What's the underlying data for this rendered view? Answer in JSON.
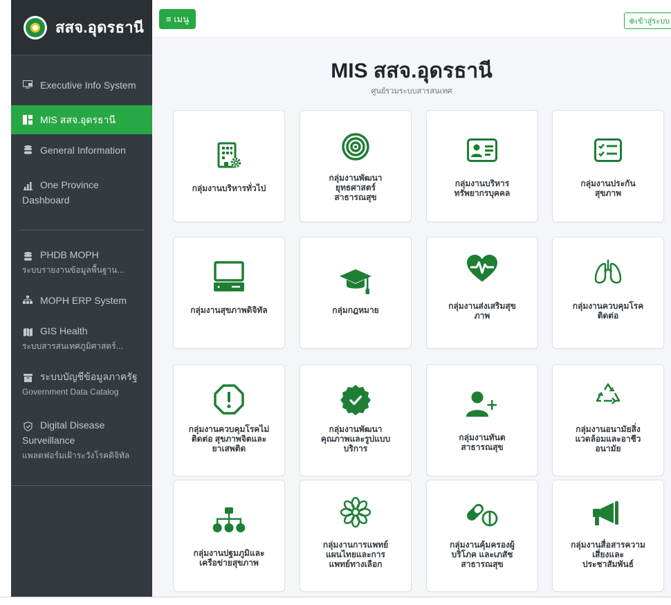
{
  "brand": {
    "title": "สสจ.อุดรธานี"
  },
  "topbar": {
    "menu_label": "≡ เมนู",
    "login_label": "⊕เข้าสู่ระบบ"
  },
  "sidebar": {
    "items": [
      {
        "label": "Executive Info System",
        "sub": "",
        "icon": "monitor-icon"
      },
      {
        "label": "MIS สสจ.อุดรธานี",
        "sub": "",
        "icon": "dashboard-icon",
        "active": true
      },
      {
        "label": "General Information",
        "sub": "",
        "icon": "database-icon"
      },
      {
        "label": "One Province",
        "label2": "Dashboard",
        "sub": "",
        "icon": "bar-chart-icon"
      },
      {
        "label": "PHDB MOPH",
        "sub": "ระบบรายงานข้อมูลพื้นฐาน...",
        "icon": "database-icon"
      },
      {
        "label": "MOPH ERP System",
        "sub": "",
        "icon": "sitemap-icon"
      },
      {
        "label": "GIS Health",
        "sub": "ระบบสารสนเทศภูมิศาสตร์...",
        "icon": "map-icon"
      },
      {
        "label": "ระบบบัญชีข้อมูลภาครัฐ",
        "sub": "Government Data Catalog",
        "icon": "archive-icon"
      },
      {
        "label": "Digital Disease",
        "label2": "Surveillance",
        "sub": "แพลตฟอร์มเฝ้าระวังโรคดิจิทัล",
        "icon": "shield-icon"
      }
    ]
  },
  "main": {
    "title": "MIS สสจ.อุดรธานี",
    "subtitle": "ศูนย์รวมระบบสารสนเทศ",
    "cards": [
      {
        "lines": [
          "กลุ่มงานบริหารทั่วไป"
        ],
        "icon": "building-gear-icon"
      },
      {
        "lines": [
          "กลุ่มงานพัฒนา",
          "ยุทธศาสตร์",
          "สาธารณสุข"
        ],
        "icon": "target-icon"
      },
      {
        "lines": [
          "กลุ่มงานบริหาร",
          "ทรัพยากรบุคคล"
        ],
        "icon": "id-card-icon"
      },
      {
        "lines": [
          "กลุ่มงานประกัน",
          "สุขภาพ"
        ],
        "icon": "checklist-icon"
      },
      {
        "lines": [
          "กลุ่มงานสุขภาพดิจิทัล"
        ],
        "icon": "computer-icon"
      },
      {
        "lines": [
          "กลุ่มกฎหมาย"
        ],
        "icon": "graduation-cap-icon"
      },
      {
        "lines": [
          "กลุ่มงานส่งเสริมสุข",
          "ภาพ"
        ],
        "icon": "heartbeat-icon"
      },
      {
        "lines": [
          "กลุ่มงานควบคุมโรค",
          "ติดต่อ"
        ],
        "icon": "lungs-icon"
      },
      {
        "lines": [
          "กลุ่มงานควบคุมโรคไม่",
          "ติดต่อ สุขภาพจิตและ",
          "ยาเสพติด"
        ],
        "icon": "exclamation-octagon-icon"
      },
      {
        "lines": [
          "กลุ่มงานพัฒนา",
          "คุณภาพและรูปแบบ",
          "บริการ"
        ],
        "icon": "badge-check-icon"
      },
      {
        "lines": [
          "กลุ่มงานทันต",
          "สาธารณสุข"
        ],
        "icon": "user-plus-icon"
      },
      {
        "lines": [
          "กลุ่มงานอนามัยสิ่ง",
          "แวดล้อมและอาชีว",
          "อนามัย"
        ],
        "icon": "recycle-icon"
      },
      {
        "lines": [
          "กลุ่มงานปฐมภูมิและ",
          "เครือข่ายสุขภาพ"
        ],
        "icon": "network-icon"
      },
      {
        "lines": [
          "กลุ่มงานการแพทย์",
          "แผนไทยและการ",
          "แพทย์ทางเลือก"
        ],
        "icon": "flower-icon"
      },
      {
        "lines": [
          "กลุ่มงานคุ้มครองผู้",
          "บริโภค และเภสัช",
          "สาธารณสุข"
        ],
        "icon": "pills-icon"
      },
      {
        "lines": [
          "กลุ่มงานสื่อสารความ",
          "เสี่ยงและ",
          "ประชาสัมพันธ์"
        ],
        "icon": "megaphone-icon"
      }
    ]
  },
  "colors": {
    "accent": "#28a745",
    "sidebar": "#343a40",
    "icon_green": "#1e7e34"
  }
}
